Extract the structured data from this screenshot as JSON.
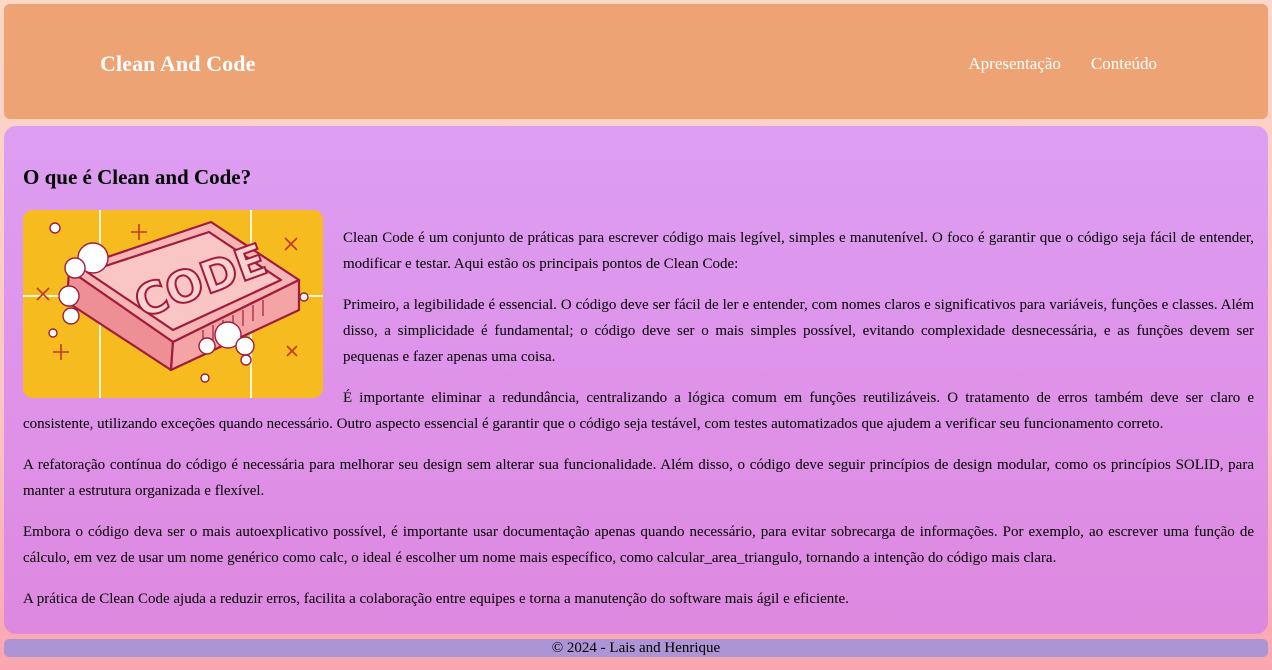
{
  "header": {
    "brand": "Clean And Code",
    "nav": [
      {
        "label": "Apresentação"
      },
      {
        "label": "Conteúdo"
      }
    ]
  },
  "main": {
    "title": "O que é Clean and Code?",
    "image_icon": "code-soap-bar-illustration",
    "image_text": "CODE",
    "paragraphs": [
      "Clean Code é um conjunto de práticas para escrever código mais legível, simples e manutenível. O foco é garantir que o código seja fácil de entender, modificar e testar. Aqui estão os principais pontos de Clean Code:",
      "Primeiro, a legibilidade é essencial. O código deve ser fácil de ler e entender, com nomes claros e significativos para variáveis, funções e classes. Além disso, a simplicidade é fundamental; o código deve ser o mais simples possível, evitando complexidade desnecessária, e as funções devem ser pequenas e fazer apenas uma coisa.",
      "É importante eliminar a redundância, centralizando a lógica comum em funções reutilizáveis. O tratamento de erros também deve ser claro e consistente, utilizando exceções quando necessário. Outro aspecto essencial é garantir que o código seja testável, com testes automatizados que ajudem a verificar seu funcionamento correto.",
      "A refatoração contínua do código é necessária para melhorar seu design sem alterar sua funcionalidade. Além disso, o código deve seguir princípios de design modular, como os princípios SOLID, para manter a estrutura organizada e flexível.",
      "Embora o código deva ser o mais autoexplicativo possível, é importante usar documentação apenas quando necessário, para evitar sobrecarga de informações. Por exemplo, ao escrever uma função de cálculo, em vez de usar um nome genérico como calc, o ideal é escolher um nome mais específico, como calcular_area_triangulo, tornando a intenção do código mais clara.",
      "A prática de Clean Code ajuda a reduzir erros, facilita a colaboração entre equipes e torna a manutenção do software mais ágil e eficiente."
    ]
  },
  "footer": {
    "text": "© 2024 - Lais and Henrique"
  },
  "colors": {
    "header_bg": "#eea374",
    "content_bg": "#dd9ef2",
    "footer_bg": "#ac94d5",
    "image_bg": "#f6bb1f",
    "soap_fill": "#f7b4b4",
    "soap_stroke": "#a01c3c"
  }
}
